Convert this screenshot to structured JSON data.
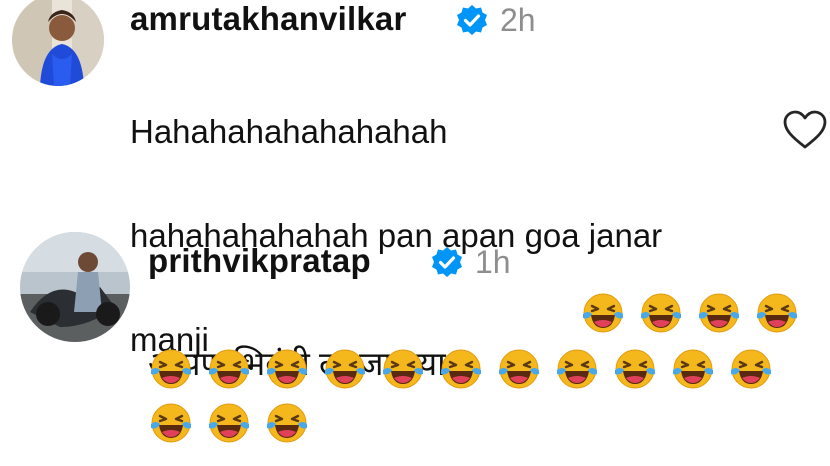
{
  "comments": [
    {
      "username": "amrutakhanvilkar",
      "verified": true,
      "time": "2h",
      "text_lines": [
        "Hahahahahahahahah",
        "hahahahahahah pan apan goa janar",
        "manji"
      ],
      "liked": false
    },
    {
      "username": "prithvikpratap",
      "verified": true,
      "time": "1h",
      "text": "आपण भिवंडी ला जाऊया?",
      "emoji": "rolling-on-floor-laughing",
      "emoji_count": 18
    }
  ],
  "colors": {
    "verified_blue": "#0095f6",
    "timestamp_gray": "#8e8e8e",
    "text": "#111111",
    "emoji_yellow": "#f5b81c"
  },
  "icons": [
    "verified-badge-icon",
    "heart-outline-icon",
    "laughing-emoji-icon"
  ]
}
